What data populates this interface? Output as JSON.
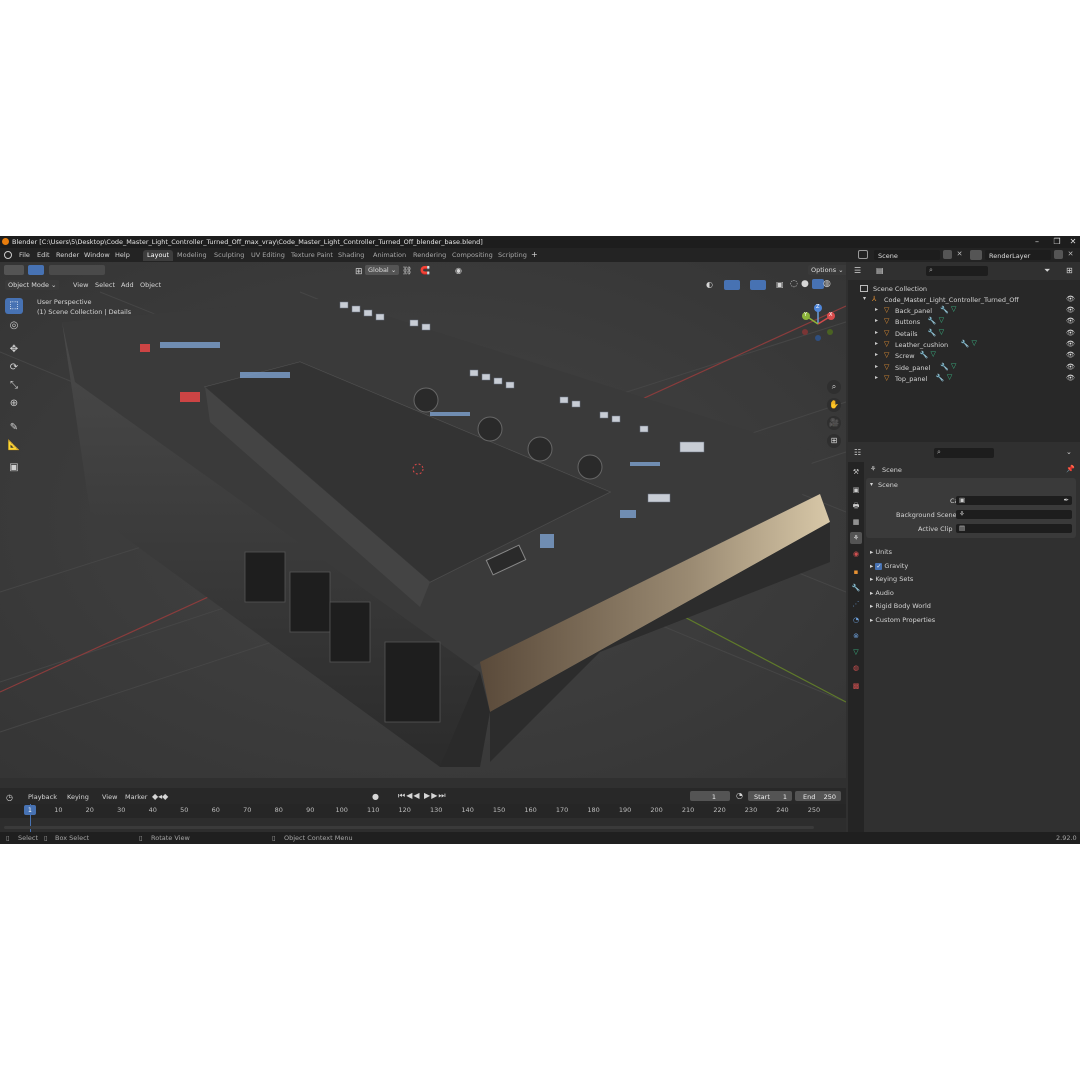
{
  "window": {
    "title": "Blender [C:\\Users\\5\\Desktop\\Code_Master_Light_Controller_Turned_Off_max_vray\\Code_Master_Light_Controller_Turned_Off_blender_base.blend]",
    "min_glyph": "–",
    "max_glyph": "❐",
    "close_glyph": "✕"
  },
  "menus": [
    "File",
    "Edit",
    "Render",
    "Window",
    "Help"
  ],
  "workspaces": [
    "Layout",
    "Modeling",
    "Sculpting",
    "UV Editing",
    "Texture Paint",
    "Shading",
    "Animation",
    "Rendering",
    "Compositing",
    "Scripting"
  ],
  "add_workspace": "+",
  "topbar": {
    "scene": "Scene",
    "view_layer": "RenderLayer"
  },
  "viewport": {
    "mode": "Object Mode",
    "menus": [
      "View",
      "Select",
      "Add",
      "Object"
    ],
    "transform_orientation": "Global",
    "options_label": "Options",
    "overlay_line1": "User Perspective",
    "overlay_line2": "(1) Scene Collection | Details",
    "gizmo": {
      "x": "X",
      "y": "Y",
      "z": "Z"
    }
  },
  "timeline": {
    "menus": [
      "Playback",
      "Keying",
      "View",
      "Marker"
    ],
    "current_frame": "1",
    "start_label": "Start",
    "start": "1",
    "end_label": "End",
    "end": "250",
    "ticks": [
      "1",
      "10",
      "20",
      "30",
      "40",
      "50",
      "60",
      "70",
      "80",
      "90",
      "100",
      "110",
      "120",
      "130",
      "140",
      "150",
      "160",
      "170",
      "180",
      "190",
      "200",
      "210",
      "220",
      "230",
      "240",
      "250"
    ],
    "playhead": "1"
  },
  "outliner": {
    "root": "Scene Collection",
    "collection": "Code_Master_Light_Controller_Turned_Off",
    "objects": [
      "Back_panel",
      "Buttons",
      "Details",
      "Leather_cushion",
      "Screw",
      "Side_panel",
      "Top_panel"
    ]
  },
  "properties": {
    "header": "Scene",
    "panel": "Scene",
    "camera_label": "Camera",
    "background_label": "Background Scene",
    "active_clip_label": "Active Clip",
    "sections": [
      "Units",
      "Gravity",
      "Keying Sets",
      "Audio",
      "Rigid Body World",
      "Custom Properties"
    ],
    "gravity_checked": true
  },
  "status": {
    "select": "Select",
    "box_select": "Box Select",
    "rotate_view": "Rotate View",
    "context_menu": "Object Context Menu",
    "version": "2.92.0"
  },
  "colors": {
    "accent": "#4772b3",
    "axis_x": "#b84a4a",
    "axis_y": "#7a9a2e",
    "object_orange": "#e89233",
    "mesh_green": "#3bbf8a",
    "modifier_blue": "#6c9ed8"
  }
}
